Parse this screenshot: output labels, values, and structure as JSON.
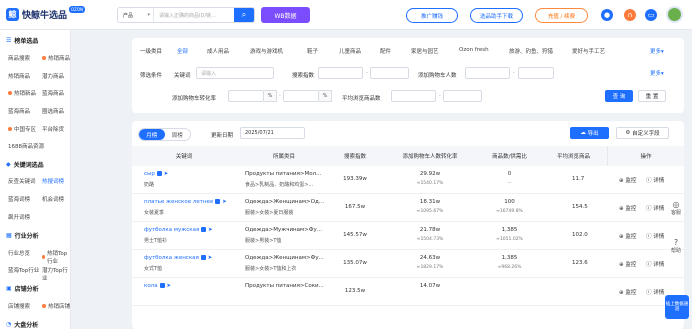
{
  "brand": {
    "name": "快鲸牛选品",
    "badge": "OZON"
  },
  "search": {
    "category": "产品",
    "placeholder": "请输入正确的商品ID/链..."
  },
  "top": {
    "wb": "WB数据",
    "promo": "推广赚钱",
    "helper": "选品助手下载",
    "vip": "充值 / 续费"
  },
  "sidebar": {
    "s1": "榜单选品",
    "s1_items": [
      "商品搜索",
      "热销商品",
      "热销新品",
      "蓝海商品",
      "中国专区",
      "1688商品资源"
    ],
    "s1_right": [
      "热销商品",
      "潜力商品",
      "蓝海商品",
      "圈选商品",
      "平台除货"
    ],
    "s2": "关键词选品",
    "s2_items": [
      "反查关键词",
      "蓝海词榜",
      "趋势词",
      "飙升词榜"
    ],
    "s2_right": [
      "热搜词榜",
      "机会词榜"
    ],
    "s3": "行业分析",
    "s3_items": [
      "行业总览",
      "蓝海Top行业"
    ],
    "s3_right": [
      "热销Top行业",
      "潜力Top行业"
    ],
    "s4": "店铺分析",
    "s4_items": [
      "店铺搜索"
    ],
    "s4_right": [
      "热销店铺"
    ],
    "s5": "大盘分析"
  },
  "filter": {
    "cat_label": "一级类目",
    "cats": [
      "全部",
      "成人用品",
      "游戏与游戏机",
      "鞋子",
      "儿童商品",
      "配件",
      "家居与园艺",
      "Ozon fresh",
      "旅游、钓鱼、狩猎",
      "爱好与手工艺"
    ],
    "more": "更多",
    "cond_label": "筛选条件",
    "kw_label": "关键词",
    "kw_placeholder": "请输入",
    "search_idx": "搜索指数",
    "cart_count": "添加购物车人数",
    "cart_rate": "添加购物车转化率",
    "pct": "%",
    "avg_view": "平均浏览商品数",
    "query": "查 询",
    "reset": "重 置"
  },
  "table": {
    "tab_month": "月榜",
    "tab_week": "周榜",
    "date_label": "更新日期",
    "date": "2025/07/21",
    "export": "导出",
    "custom": "自定义字段",
    "headers": [
      "关键词",
      "所属类目",
      "搜索指数",
      "添加购物车人数转化率",
      "商品数/供需比",
      "平均浏览商品",
      "操作"
    ],
    "rows": [
      {
        "kw": "сыр",
        "kw_cn": "奶酪",
        "cat": "Продукты питания>Мол...",
        "cat_cn": "食品>乳制品、奶酪和鸡蛋>...",
        "idx": "193.39w",
        "rate": "29.92w",
        "rate2": "≈1540.17%",
        "num": "0",
        "ratio": "--",
        "avg": "11.7"
      },
      {
        "kw": "платье женское летнее",
        "kw_cn": "女装夏季",
        "cat": "Одежда>Женщинам>Од...",
        "cat_cn": "服装>女装>夏日服装",
        "idx": "167.5w",
        "rate": "18.31w",
        "rate2": "≈1095.67%",
        "num": "100",
        "ratio": "≈16749.8%",
        "avg": "154.5"
      },
      {
        "kw": "футболка мужская",
        "kw_cn": "男士T恤衫",
        "cat": "Одежда>Мужчинам>Фу...",
        "cat_cn": "服装>男装>T恤",
        "idx": "145.57w",
        "rate": "21.78w",
        "rate2": "≈1504.73%",
        "num": "1,385",
        "ratio": "≈1051.02%",
        "avg": "102.0"
      },
      {
        "kw": "футболка женская",
        "kw_cn": "女式T恤",
        "cat": "Одежда>Женщинам>Фу...",
        "cat_cn": "服装>女装>T恤和上衣",
        "idx": "135.07w",
        "rate": "24.63w",
        "rate2": "≈1829.17%",
        "num": "1,385",
        "ratio": "≈968.26%",
        "avg": "123.6"
      },
      {
        "kw": "кола",
        "kw_cn": "",
        "cat": "Продукты питания>Соки...",
        "cat_cn": "",
        "idx": "123.5w",
        "rate": "14.07w",
        "rate2": "",
        "num": "",
        "ratio": "",
        "avg": ""
      }
    ],
    "act_monitor": "监控",
    "act_detail": "详情"
  },
  "rail": {
    "service": "客服",
    "help": "帮助",
    "float": "插上数据通道"
  }
}
